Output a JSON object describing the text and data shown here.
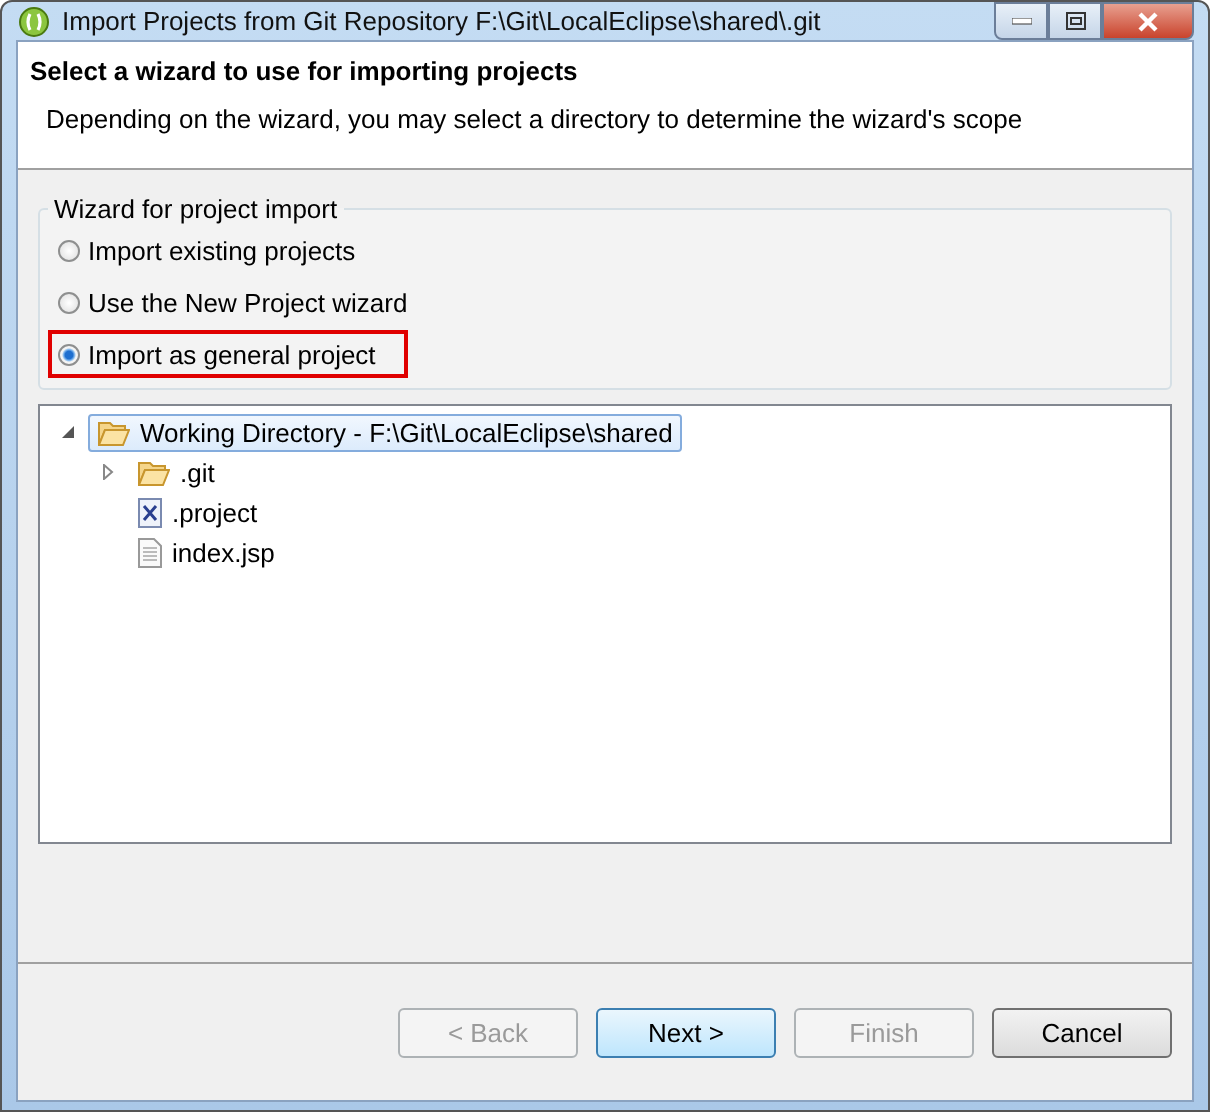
{
  "window": {
    "title": "Import Projects from Git Repository F:\\Git\\LocalEclipse\\shared\\.git"
  },
  "header": {
    "title": "Select a wizard to use for importing projects",
    "description": "Depending on the wizard, you may select a directory to determine the wizard's scope"
  },
  "wizard_group": {
    "label": "Wizard for project import",
    "options": [
      {
        "label": "Import existing projects",
        "selected": false,
        "highlighted": false
      },
      {
        "label": "Use the New Project wizard",
        "selected": false,
        "highlighted": false
      },
      {
        "label": "Import as general project",
        "selected": true,
        "highlighted": true
      }
    ]
  },
  "tree": [
    {
      "label": "Working Directory - F:\\Git\\LocalEclipse\\shared",
      "kind": "folder",
      "expanded": true,
      "selected": true,
      "children": [
        {
          "label": ".git",
          "kind": "folder",
          "expanded": false,
          "selected": false
        },
        {
          "label": ".project",
          "kind": "xml-file",
          "selected": false
        },
        {
          "label": "index.jsp",
          "kind": "file",
          "selected": false
        }
      ]
    }
  ],
  "buttons": [
    {
      "label": "< Back",
      "disabled": true,
      "default": false
    },
    {
      "label": "Next >",
      "disabled": false,
      "default": true
    },
    {
      "label": "Finish",
      "disabled": true,
      "default": false
    },
    {
      "label": "Cancel",
      "disabled": false,
      "default": false
    }
  ]
}
